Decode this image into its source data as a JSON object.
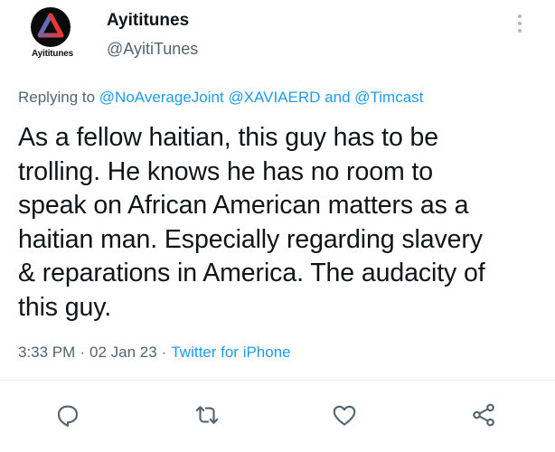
{
  "author": {
    "display_name": "Ayititunes",
    "handle": "@AyitiTunes",
    "avatar_label": "Ayititunes"
  },
  "reply": {
    "prefix": "Replying to",
    "user1": "@NoAverageJoint",
    "user2": "@XAVIAERD",
    "conjunction": "and",
    "user3": "@Timcast"
  },
  "tweet": {
    "lines": [
      "As a fellow haitian, this guy has to be",
      "trolling. He knows he has no room to",
      "speak on African American matters as a",
      "haitian man. Especially regarding slavery",
      "& reparations in America. The audacity of",
      "this guy."
    ]
  },
  "meta": {
    "time": "3:33 PM",
    "separator": "·",
    "date": "02 Jan 23",
    "source": "Twitter for iPhone"
  },
  "colors": {
    "link": "#1d9bf0",
    "secondary": "#536471",
    "text": "#0f1419"
  },
  "icons": [
    "more-icon",
    "reply-icon",
    "retweet-icon",
    "like-icon",
    "share-icon"
  ]
}
